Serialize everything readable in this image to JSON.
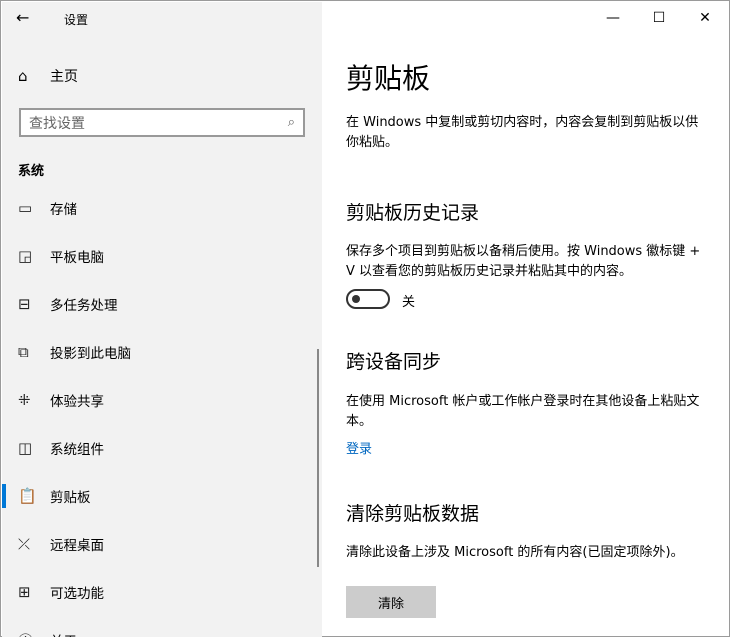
{
  "app_title": "设置",
  "sidebar": {
    "home": "主页",
    "search_placeholder": "查找设置",
    "section": "系统",
    "items": [
      {
        "label": "存储",
        "icon": "storage-icon",
        "glyph": "▭"
      },
      {
        "label": "平板电脑",
        "icon": "tablet-icon",
        "glyph": "◲"
      },
      {
        "label": "多任务处理",
        "icon": "multitasking-icon",
        "glyph": "⊟"
      },
      {
        "label": "投影到此电脑",
        "icon": "project-icon",
        "glyph": "⧉"
      },
      {
        "label": "体验共享",
        "icon": "share-icon",
        "glyph": "⁜"
      },
      {
        "label": "系统组件",
        "icon": "components-icon",
        "glyph": "◫"
      },
      {
        "label": "剪贴板",
        "icon": "clipboard-icon",
        "glyph": "📋"
      },
      {
        "label": "远程桌面",
        "icon": "remote-desktop-icon",
        "glyph": "⤫"
      },
      {
        "label": "可选功能",
        "icon": "optional-features-icon",
        "glyph": "⊞"
      },
      {
        "label": "关于",
        "icon": "info-icon",
        "glyph": "ⓘ"
      }
    ],
    "selected": "剪贴板"
  },
  "main": {
    "title": "剪贴板",
    "intro": "在 Windows 中复制或剪切内容时，内容会复制到剪贴板以供你粘贴。",
    "history_heading": "剪贴板历史记录",
    "history_desc": "保存多个项目到剪贴板以备稍后使用。按 Windows 徽标键 + V 以查看您的剪贴板历史记录并粘贴其中的内容。",
    "history_toggle": "关",
    "sync_heading": "跨设备同步",
    "sync_desc": "在使用 Microsoft 帐户或工作帐户登录时在其他设备上粘贴文本。",
    "sync_link": "登录",
    "clear_heading": "清除剪贴板数据",
    "clear_desc": "清除此设备上涉及 Microsoft 的所有内容(已固定项除外)。",
    "clear_button": "清除"
  },
  "accent": "#0078d7"
}
